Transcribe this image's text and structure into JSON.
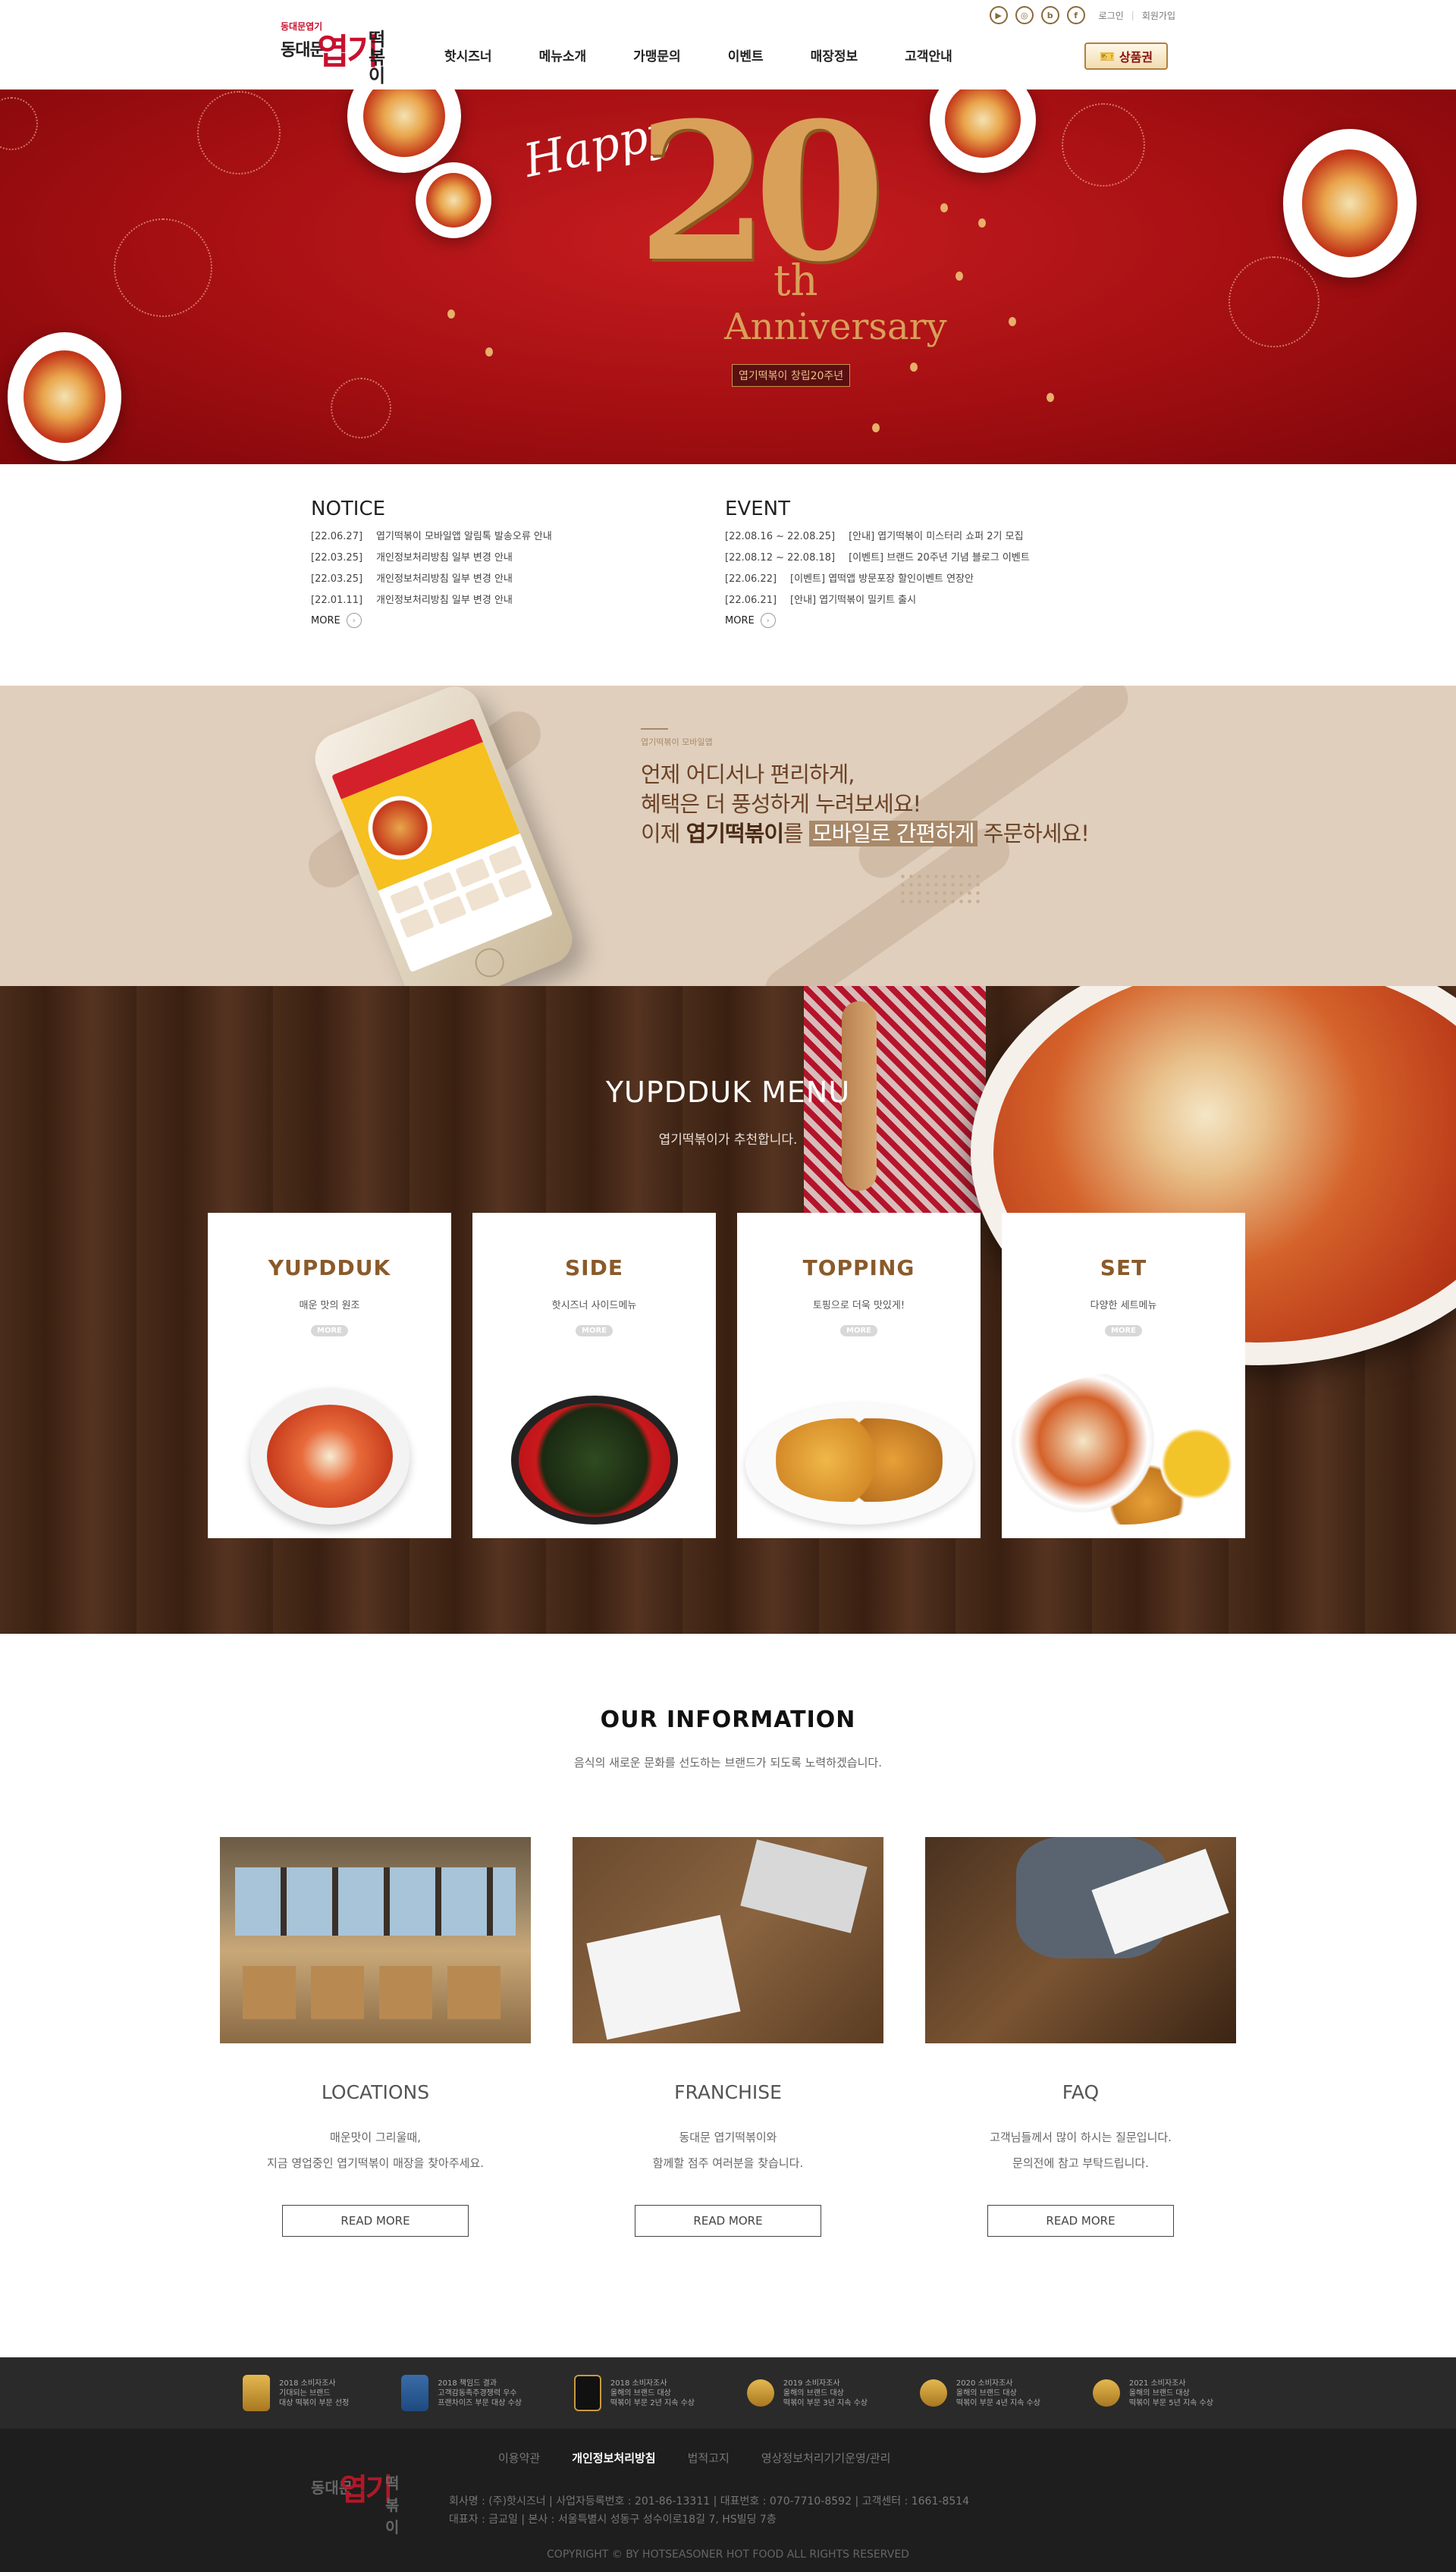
{
  "header": {
    "logo": {
      "small": "동대문엽기",
      "left": "동대문",
      "big": "엽기",
      "right": "떡볶이"
    },
    "sns": [
      "youtube-icon",
      "instagram-icon",
      "blog-icon",
      "facebook-icon"
    ],
    "util": {
      "login": "로그인",
      "join": "회원가입"
    },
    "nav": [
      "핫시즈너",
      "메뉴소개",
      "가맹문의",
      "이벤트",
      "매장정보",
      "고객안내"
    ],
    "gift_label": "상품권"
  },
  "hero": {
    "happy": "Happy",
    "number": "20",
    "th": "th",
    "anniversary": "Anniversary",
    "badge": "엽기떡볶이 창립20주년"
  },
  "notice": {
    "title": "NOTICE",
    "items": [
      {
        "date": "[22.06.27]",
        "text": "엽기떡볶이 모바일앱 알림톡 발송오류 안내"
      },
      {
        "date": "[22.03.25]",
        "text": "개인정보처리방침 일부 변경 안내"
      },
      {
        "date": "[22.03.25]",
        "text": "개인정보처리방침 일부 변경 안내"
      },
      {
        "date": "[22.01.11]",
        "text": "개인정보처리방침 일부 변경 안내"
      }
    ],
    "more": "MORE"
  },
  "event": {
    "title": "EVENT",
    "items": [
      {
        "date": "[22.08.16 ~ 22.08.25]",
        "text": "[안내] 엽기떡볶이 미스터리 쇼퍼 2기 모집"
      },
      {
        "date": "[22.08.12 ~ 22.08.18]",
        "text": "[이벤트] 브랜드 20주년 기념 블로그 이벤트"
      },
      {
        "date": "[22.06.22]",
        "text": "[이벤트] 엽떡앱 방문포장 할인이벤트 연장안"
      },
      {
        "date": "[22.06.21]",
        "text": "[안내] 엽기떡볶이 밀키트 출시"
      }
    ],
    "more": "MORE"
  },
  "app": {
    "eyebrow": "엽기떡볶이 모바일앱",
    "line1": "언제 어디서나 편리하게,",
    "line2": "혜택은 더 풍성하게 누려보세요!",
    "line3_a": "이제 ",
    "line3_b": "엽기떡볶이",
    "line3_c": "를 ",
    "line3_d": "모바일로 간편하게",
    "line3_e": " 주문하세요!"
  },
  "menu": {
    "title": "YUPDDUK MENU",
    "subtitle": "엽기떡볶이가 추천합니다.",
    "cards": [
      {
        "name": "YUPDDUK",
        "desc": "매운 맛의 원조",
        "more": "MORE"
      },
      {
        "name": "SIDE",
        "desc": "핫시즈너 사이드메뉴",
        "more": "MORE"
      },
      {
        "name": "TOPPING",
        "desc": "토핑으로 더욱 맛있게!",
        "more": "MORE"
      },
      {
        "name": "SET",
        "desc": "다양한 세트메뉴",
        "more": "MORE"
      }
    ]
  },
  "info": {
    "title": "OUR INFORMATION",
    "subtitle": "음식의 새로운 문화를 선도하는 브랜드가 되도록 노력하겠습니다.",
    "cols": [
      {
        "title": "LOCATIONS",
        "line1": "매운맛이 그리울때,",
        "line2": "지금 영업중인 엽기떡볶이 매장을 찾아주세요.",
        "button": "READ MORE"
      },
      {
        "title": "FRANCHISE",
        "line1": "동대문 엽기떡볶이와",
        "line2": "함께할 점주 여러분을 찾습니다.",
        "button": "READ MORE"
      },
      {
        "title": "FAQ",
        "line1": "고객님들께서 많이 하시는 질문입니다.",
        "line2": "문의전에 참고 부탁드립니다.",
        "button": "READ MORE"
      }
    ]
  },
  "awards": [
    {
      "l1": "2018 소비자조사",
      "l2": "기대되는 브랜드",
      "l3": "대상 떡볶이 부문 선정"
    },
    {
      "l1": "2018 책임드 결과",
      "l2": "고객감동족주경쟁력 우수",
      "l3": "프랜차이즈 부문 대상 수상"
    },
    {
      "l1": "2018 소비자조사",
      "l2": "올해의 브랜드 대상",
      "l3": "떡볶이 부문 2년 지속 수상"
    },
    {
      "l1": "2019 소비자조사",
      "l2": "올해의 브랜드 대상",
      "l3": "떡볶이 부문 3년 지속 수상"
    },
    {
      "l1": "2020 소비자조사",
      "l2": "올해의 브랜드 대상",
      "l3": "떡볶이 부문 4년 지속 수상"
    },
    {
      "l1": "2021 소비자조사",
      "l2": "올해의 브랜드 대상",
      "l3": "떡볶이 부문 5년 지속 수상"
    }
  ],
  "footer": {
    "logo": {
      "l1": "동대문",
      "l2": "엽기",
      "l3": "떡볶이"
    },
    "links": [
      "이용약관",
      "개인정보처리방침",
      "법적고지",
      "영상정보처리기기운영/관리"
    ],
    "addr1": "회사명 : (주)핫시즈너   |   사업자등록번호 : 201-86-13311   |   대표번호 : 070-7710-8592   |   고객센터 : 1661-8514",
    "addr2": "대표자 : 금교일   |   본사 : 서울특별시 성동구 성수이로18길 7, HS빌딩 7층",
    "copyright": "COPYRIGHT © BY HOTSEASONER HOT FOOD ALL RIGHTS RESERVED"
  }
}
